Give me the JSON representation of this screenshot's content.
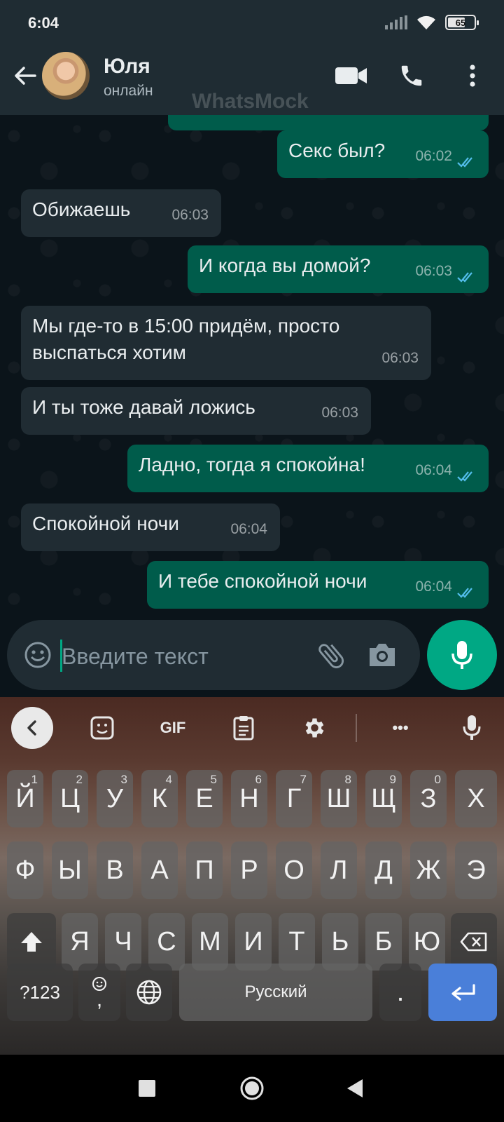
{
  "status_bar": {
    "time": "6:04",
    "battery": "65"
  },
  "header": {
    "contact_name": "Юля",
    "contact_status": "онлайн",
    "watermark": "WhatsMock"
  },
  "messages": [
    {
      "dir": "out",
      "text": "Секс был?",
      "time": "06:02"
    },
    {
      "dir": "in",
      "text": "Обижаешь",
      "time": "06:03"
    },
    {
      "dir": "out",
      "text": "И когда вы домой?",
      "time": "06:03"
    },
    {
      "dir": "in",
      "text": "Мы где-то в 15:00 придём, просто выспаться хотим",
      "time": "06:03"
    },
    {
      "dir": "in",
      "text": "И ты тоже давай ложись",
      "time": "06:03"
    },
    {
      "dir": "out",
      "text": "Ладно, тогда я спокойна!",
      "time": "06:04"
    },
    {
      "dir": "in",
      "text": "Спокойной ночи",
      "time": "06:04"
    },
    {
      "dir": "out",
      "text": "И тебе спокойной ночи",
      "time": "06:04"
    }
  ],
  "composer": {
    "placeholder": "Введите текст"
  },
  "keyboard": {
    "toolbar": {
      "gif": "GIF",
      "more": "•••"
    },
    "row1": [
      {
        "k": "Й",
        "h": "1"
      },
      {
        "k": "Ц",
        "h": "2"
      },
      {
        "k": "У",
        "h": "3"
      },
      {
        "k": "К",
        "h": "4"
      },
      {
        "k": "Е",
        "h": "5"
      },
      {
        "k": "Н",
        "h": "6"
      },
      {
        "k": "Г",
        "h": "7"
      },
      {
        "k": "Ш",
        "h": "8"
      },
      {
        "k": "Щ",
        "h": "9"
      },
      {
        "k": "З",
        "h": "0"
      },
      {
        "k": "Х",
        "h": ""
      }
    ],
    "row2": [
      "Ф",
      "Ы",
      "В",
      "А",
      "П",
      "Р",
      "О",
      "Л",
      "Д",
      "Ж",
      "Э"
    ],
    "row3": [
      "Я",
      "Ч",
      "С",
      "М",
      "И",
      "Т",
      "Ь",
      "Б",
      "Ю"
    ],
    "symbols_label": "?123",
    "comma_label": ",",
    "space_label": "Русский",
    "period_label": "."
  },
  "colors": {
    "outgoing_bubble": "#005c4b",
    "incoming_bubble": "#202c33",
    "accent": "#00a884",
    "read_ticks": "#53bdeb"
  }
}
